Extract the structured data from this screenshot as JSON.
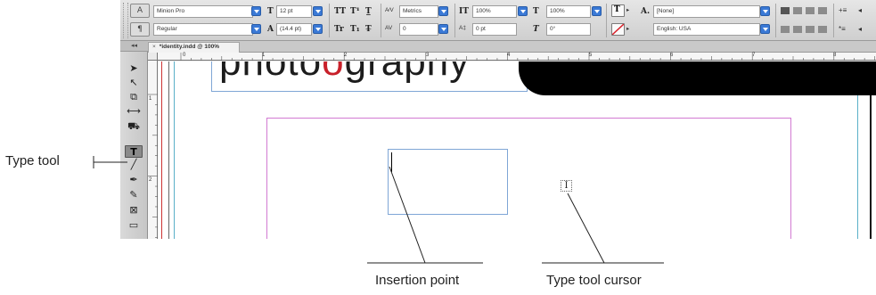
{
  "control_panel": {
    "char_mode_icon": "A",
    "para_mode_icon": "¶",
    "font_family": "Minion Pro",
    "font_style": "Regular",
    "font_size": "12 pt",
    "leading": "(14.4 pt)",
    "kerning": "Metrics",
    "tracking": "0",
    "vertical_scale": "100%",
    "horizontal_scale": "100%",
    "baseline_shift": "0 pt",
    "skew": "0°",
    "character_style": "[None]",
    "language": "English: USA",
    "caps_icons": [
      "TT",
      "T¹",
      "T̲"
    ],
    "caps_icons_row2": [
      "Tr",
      "T₁",
      "T̶"
    ]
  },
  "document_tab": {
    "close_glyph": "×",
    "title": "*identity.indd @ 100%"
  },
  "tools_panel": {
    "header_glyph": "◂◂",
    "tools": [
      {
        "name": "selection-tool",
        "glyph": "➤"
      },
      {
        "name": "direct-selection-tool",
        "glyph": "↖"
      },
      {
        "name": "page-tool",
        "glyph": "⧉"
      },
      {
        "name": "gap-tool",
        "glyph": "⟷"
      },
      {
        "name": "content-collector-tool",
        "glyph": "⛟"
      },
      {
        "name": "type-tool",
        "glyph": "T"
      },
      {
        "name": "line-tool",
        "glyph": "╱"
      },
      {
        "name": "pen-tool",
        "glyph": "✒"
      },
      {
        "name": "pencil-tool",
        "glyph": "✎"
      },
      {
        "name": "rectangle-frame-tool",
        "glyph": "⊠"
      },
      {
        "name": "rectangle-tool",
        "glyph": "▭"
      }
    ]
  },
  "ruler": {
    "numbers": [
      "0",
      "1",
      "2",
      "3",
      "4",
      "5",
      "6",
      "7",
      "8"
    ],
    "v_numbers": [
      "1",
      "2"
    ]
  },
  "canvas": {
    "logo_text_before": "photo",
    "logo_o": "o",
    "logo_text_after": "graphy",
    "cursor_glyph": "I"
  },
  "callouts": {
    "type_tool": "Type tool",
    "insertion_point": "Insertion point",
    "type_tool_cursor": "Type tool cursor"
  }
}
